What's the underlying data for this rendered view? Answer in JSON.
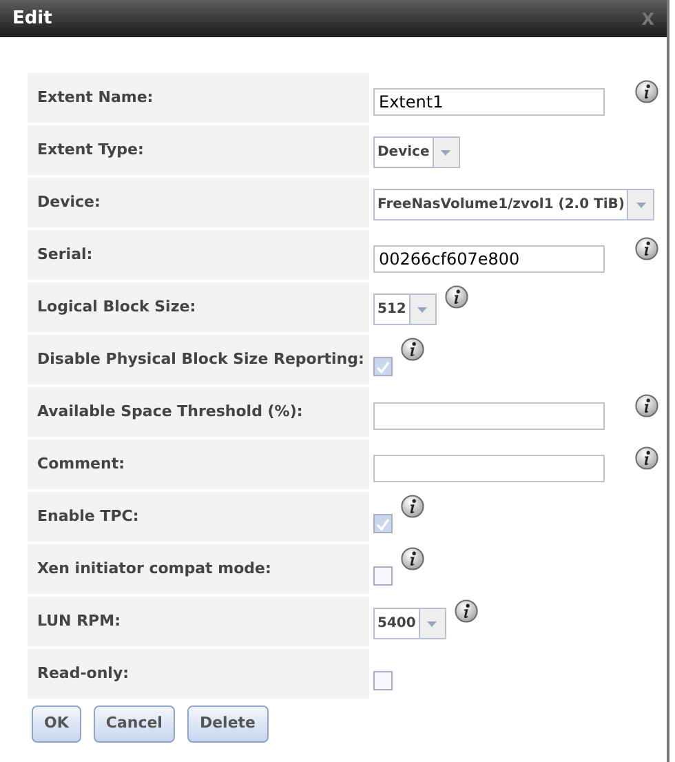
{
  "window": {
    "title": "Edit",
    "close": "X"
  },
  "fields": [
    {
      "label": "Extent Name:",
      "kind": "text",
      "value": "Extent1",
      "info": true
    },
    {
      "label": "Extent Type:",
      "kind": "select",
      "value": "Device",
      "info": false
    },
    {
      "label": "Device:",
      "kind": "select",
      "value": "FreeNasVolume1/zvol1 (2.0 TiB)",
      "info": false
    },
    {
      "label": "Serial:",
      "kind": "text",
      "value": "00266cf607e800",
      "info": true
    },
    {
      "label": "Logical Block Size:",
      "kind": "select",
      "value": "512",
      "info": true
    },
    {
      "label": "Disable Physical Block Size Reporting:",
      "kind": "checkbox",
      "checked": true,
      "info": true
    },
    {
      "label": "Available Space Threshold (%):",
      "kind": "text",
      "info": true
    },
    {
      "label": "Comment:",
      "kind": "text",
      "info": true
    },
    {
      "label": "Enable TPC:",
      "kind": "checkbox",
      "checked": true,
      "info": true
    },
    {
      "label": "Xen initiator compat mode:",
      "kind": "checkbox",
      "checked": false,
      "info": true
    },
    {
      "label": "LUN RPM:",
      "kind": "select",
      "value": "5400",
      "info": true
    },
    {
      "label": "Read-only:",
      "kind": "checkbox",
      "checked": false,
      "info": false
    }
  ],
  "buttons": [
    "OK",
    "Cancel",
    "Delete"
  ]
}
